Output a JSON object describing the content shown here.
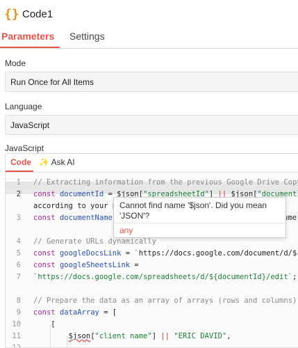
{
  "node": {
    "icon": "code-braces-icon",
    "icon_glyph": "{}",
    "title": "Code1"
  },
  "tabs": {
    "parameters": "Parameters",
    "settings": "Settings"
  },
  "fields": {
    "mode": {
      "label": "Mode",
      "value": "Run Once for All Items"
    },
    "language": {
      "label": "Language",
      "value": "JavaScript"
    },
    "javascript": {
      "label": "JavaScript"
    }
  },
  "code_tabs": {
    "code": "Code",
    "ask_ai": "✨ Ask AI"
  },
  "editor": {
    "line_numbers": [
      "1",
      "2",
      "",
      "3",
      "4",
      "5",
      "6",
      "7",
      "",
      "8",
      "9",
      "10",
      "11",
      "12"
    ],
    "lines": [
      "// Extracting information from the previous Google Drive Copy",
      "const documentId = $json[\"spreadsheetId\"] || $json[\"documentId\"]",
      "according to your n",
      "const documentName",
      "",
      "// Generate URLs dynamically",
      "const googleDocsLink = `https://docs.google.com/document/d/${d",
      "const googleSheetsLink =",
      "`https://docs.google.com/spreadsheets/d/${documentId}/edit`;",
      "",
      "// Prepare the data as an array of arrays (rows and columns)",
      "const dataArray = [",
      "    [",
      "        $json[\"client name\"] || \"ERIC DAVID\","
    ],
    "partial_line3_tail": "ume"
  },
  "tooltip": {
    "message": "Cannot find name '$json'. Did you mean 'JSON'?",
    "type": "any"
  },
  "colors": {
    "accent": "#e5534b",
    "icon": "#e8901a"
  }
}
